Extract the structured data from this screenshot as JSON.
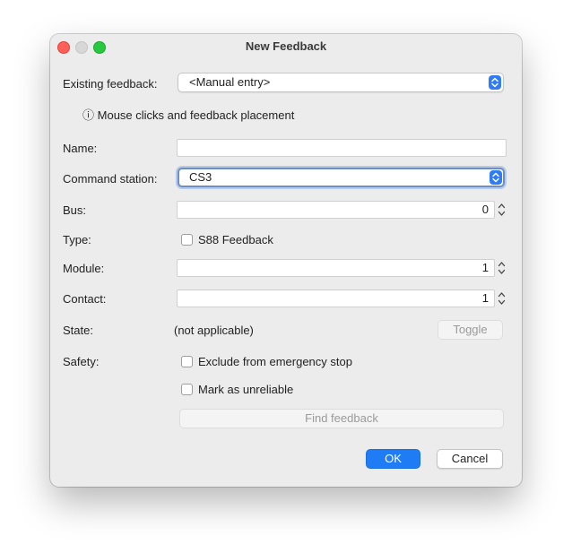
{
  "window": {
    "title": "New Feedback"
  },
  "form": {
    "existing_feedback_label": "Existing feedback:",
    "existing_feedback_value": "<Manual entry>",
    "info_icon": "ⓘ",
    "info_text": "Mouse clicks and feedback placement",
    "name_label": "Name:",
    "name_value": "",
    "command_station_label": "Command station:",
    "command_station_value": "CS3",
    "bus_label": "Bus:",
    "bus_value": "0",
    "type_label": "Type:",
    "type_checkbox_label": "S88 Feedback",
    "type_checked": false,
    "module_label": "Module:",
    "module_value": "1",
    "contact_label": "Contact:",
    "contact_value": "1",
    "state_label": "State:",
    "state_value": "(not applicable)",
    "toggle_label": "Toggle",
    "safety_label": "Safety:",
    "exclude_label": "Exclude from emergency stop",
    "unreliable_label": "Mark as unreliable",
    "find_label": "Find feedback"
  },
  "buttons": {
    "ok": "OK",
    "cancel": "Cancel"
  },
  "icons": {
    "window_close": "close-dot-icon",
    "window_minimize": "minimize-dot-icon",
    "window_zoom": "zoom-dot-icon",
    "select_arrows": "up-down-chevron-icon",
    "stepper": "stepper-arrows-icon"
  },
  "colors": {
    "accent": "#1f7cf5",
    "close": "#ff5f57",
    "zoom": "#28c840"
  }
}
